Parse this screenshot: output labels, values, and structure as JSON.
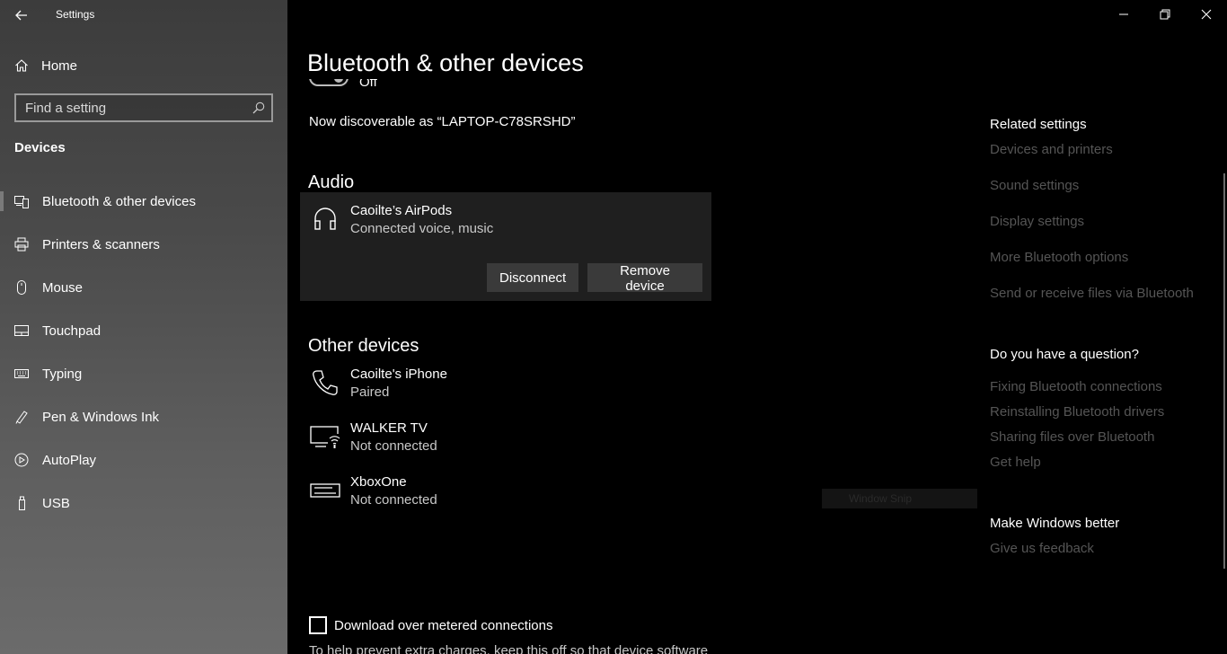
{
  "window": {
    "title": "Settings"
  },
  "sidebar": {
    "home_label": "Home",
    "search_placeholder": "Find a setting",
    "section_title": "Devices",
    "items": [
      {
        "label": "Bluetooth & other devices",
        "icon": "bluetooth-devices-icon",
        "selected": true
      },
      {
        "label": "Printers & scanners",
        "icon": "printer-icon",
        "selected": false
      },
      {
        "label": "Mouse",
        "icon": "mouse-icon",
        "selected": false
      },
      {
        "label": "Touchpad",
        "icon": "touchpad-icon",
        "selected": false
      },
      {
        "label": "Typing",
        "icon": "keyboard-icon",
        "selected": false
      },
      {
        "label": "Pen & Windows Ink",
        "icon": "pen-icon",
        "selected": false
      },
      {
        "label": "AutoPlay",
        "icon": "autoplay-icon",
        "selected": false
      },
      {
        "label": "USB",
        "icon": "usb-icon",
        "selected": false
      }
    ]
  },
  "main": {
    "page_title": "Bluetooth & other devices",
    "toggle_label": "Off",
    "discoverable_text": "Now discoverable as “LAPTOP-C78SRSHD”",
    "audio": {
      "heading": "Audio",
      "device": {
        "name": "Caoilte’s AirPods",
        "status": "Connected voice, music",
        "icon": "headphones-icon"
      },
      "disconnect_label": "Disconnect",
      "remove_label": "Remove device"
    },
    "other": {
      "heading": "Other devices",
      "devices": [
        {
          "name": "Caoilte's iPhone",
          "status": "Paired",
          "icon": "phone-icon"
        },
        {
          "name": "WALKER TV",
          "status": "Not connected",
          "icon": "wireless-display-icon"
        },
        {
          "name": "XboxOne",
          "status": "Not connected",
          "icon": "console-icon"
        }
      ]
    },
    "metered": {
      "checkbox_label": "Download over metered connections",
      "checked": false,
      "help_text": "To help prevent extra charges, keep this off so that device software"
    },
    "ghost_tooltip": "Window Snip"
  },
  "related": {
    "heading": "Related settings",
    "links": [
      "Devices and printers",
      "Sound settings",
      "Display settings",
      "More Bluetooth options",
      "Send or receive files via Bluetooth"
    ]
  },
  "question": {
    "heading": "Do you have a question?",
    "links": [
      "Fixing Bluetooth connections",
      "Reinstalling Bluetooth drivers",
      "Sharing files over Bluetooth",
      "Get help"
    ]
  },
  "better": {
    "heading": "Make Windows better",
    "links": [
      "Give us feedback"
    ]
  },
  "colors": {
    "background": "#000000",
    "card": "#1f1f1f",
    "button": "#3a3a3a",
    "link_dim": "#555555"
  }
}
